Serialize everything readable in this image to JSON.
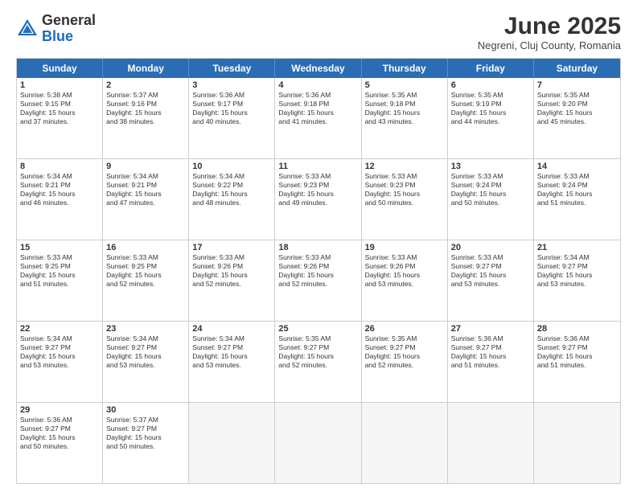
{
  "header": {
    "logo_general": "General",
    "logo_blue": "Blue",
    "month_year": "June 2025",
    "location": "Negreni, Cluj County, Romania"
  },
  "weekdays": [
    "Sunday",
    "Monday",
    "Tuesday",
    "Wednesday",
    "Thursday",
    "Friday",
    "Saturday"
  ],
  "rows": [
    [
      {
        "day": "",
        "empty": true,
        "text": ""
      },
      {
        "day": "2",
        "empty": false,
        "text": "Sunrise: 5:37 AM\nSunset: 9:16 PM\nDaylight: 15 hours\nand 38 minutes."
      },
      {
        "day": "3",
        "empty": false,
        "text": "Sunrise: 5:36 AM\nSunset: 9:17 PM\nDaylight: 15 hours\nand 40 minutes."
      },
      {
        "day": "4",
        "empty": false,
        "text": "Sunrise: 5:36 AM\nSunset: 9:18 PM\nDaylight: 15 hours\nand 41 minutes."
      },
      {
        "day": "5",
        "empty": false,
        "text": "Sunrise: 5:35 AM\nSunset: 9:18 PM\nDaylight: 15 hours\nand 43 minutes."
      },
      {
        "day": "6",
        "empty": false,
        "text": "Sunrise: 5:35 AM\nSunset: 9:19 PM\nDaylight: 15 hours\nand 44 minutes."
      },
      {
        "day": "7",
        "empty": false,
        "text": "Sunrise: 5:35 AM\nSunset: 9:20 PM\nDaylight: 15 hours\nand 45 minutes."
      }
    ],
    [
      {
        "day": "8",
        "empty": false,
        "text": "Sunrise: 5:34 AM\nSunset: 9:21 PM\nDaylight: 15 hours\nand 46 minutes."
      },
      {
        "day": "9",
        "empty": false,
        "text": "Sunrise: 5:34 AM\nSunset: 9:21 PM\nDaylight: 15 hours\nand 47 minutes."
      },
      {
        "day": "10",
        "empty": false,
        "text": "Sunrise: 5:34 AM\nSunset: 9:22 PM\nDaylight: 15 hours\nand 48 minutes."
      },
      {
        "day": "11",
        "empty": false,
        "text": "Sunrise: 5:33 AM\nSunset: 9:23 PM\nDaylight: 15 hours\nand 49 minutes."
      },
      {
        "day": "12",
        "empty": false,
        "text": "Sunrise: 5:33 AM\nSunset: 9:23 PM\nDaylight: 15 hours\nand 50 minutes."
      },
      {
        "day": "13",
        "empty": false,
        "text": "Sunrise: 5:33 AM\nSunset: 9:24 PM\nDaylight: 15 hours\nand 50 minutes."
      },
      {
        "day": "14",
        "empty": false,
        "text": "Sunrise: 5:33 AM\nSunset: 9:24 PM\nDaylight: 15 hours\nand 51 minutes."
      }
    ],
    [
      {
        "day": "15",
        "empty": false,
        "text": "Sunrise: 5:33 AM\nSunset: 9:25 PM\nDaylight: 15 hours\nand 51 minutes."
      },
      {
        "day": "16",
        "empty": false,
        "text": "Sunrise: 5:33 AM\nSunset: 9:25 PM\nDaylight: 15 hours\nand 52 minutes."
      },
      {
        "day": "17",
        "empty": false,
        "text": "Sunrise: 5:33 AM\nSunset: 9:26 PM\nDaylight: 15 hours\nand 52 minutes."
      },
      {
        "day": "18",
        "empty": false,
        "text": "Sunrise: 5:33 AM\nSunset: 9:26 PM\nDaylight: 15 hours\nand 52 minutes."
      },
      {
        "day": "19",
        "empty": false,
        "text": "Sunrise: 5:33 AM\nSunset: 9:26 PM\nDaylight: 15 hours\nand 53 minutes."
      },
      {
        "day": "20",
        "empty": false,
        "text": "Sunrise: 5:33 AM\nSunset: 9:27 PM\nDaylight: 15 hours\nand 53 minutes."
      },
      {
        "day": "21",
        "empty": false,
        "text": "Sunrise: 5:34 AM\nSunset: 9:27 PM\nDaylight: 15 hours\nand 53 minutes."
      }
    ],
    [
      {
        "day": "22",
        "empty": false,
        "text": "Sunrise: 5:34 AM\nSunset: 9:27 PM\nDaylight: 15 hours\nand 53 minutes."
      },
      {
        "day": "23",
        "empty": false,
        "text": "Sunrise: 5:34 AM\nSunset: 9:27 PM\nDaylight: 15 hours\nand 53 minutes."
      },
      {
        "day": "24",
        "empty": false,
        "text": "Sunrise: 5:34 AM\nSunset: 9:27 PM\nDaylight: 15 hours\nand 53 minutes."
      },
      {
        "day": "25",
        "empty": false,
        "text": "Sunrise: 5:35 AM\nSunset: 9:27 PM\nDaylight: 15 hours\nand 52 minutes."
      },
      {
        "day": "26",
        "empty": false,
        "text": "Sunrise: 5:35 AM\nSunset: 9:27 PM\nDaylight: 15 hours\nand 52 minutes."
      },
      {
        "day": "27",
        "empty": false,
        "text": "Sunrise: 5:36 AM\nSunset: 9:27 PM\nDaylight: 15 hours\nand 51 minutes."
      },
      {
        "day": "28",
        "empty": false,
        "text": "Sunrise: 5:36 AM\nSunset: 9:27 PM\nDaylight: 15 hours\nand 51 minutes."
      }
    ],
    [
      {
        "day": "29",
        "empty": false,
        "text": "Sunrise: 5:36 AM\nSunset: 9:27 PM\nDaylight: 15 hours\nand 50 minutes."
      },
      {
        "day": "30",
        "empty": false,
        "text": "Sunrise: 5:37 AM\nSunset: 9:27 PM\nDaylight: 15 hours\nand 50 minutes."
      },
      {
        "day": "",
        "empty": true,
        "text": ""
      },
      {
        "day": "",
        "empty": true,
        "text": ""
      },
      {
        "day": "",
        "empty": true,
        "text": ""
      },
      {
        "day": "",
        "empty": true,
        "text": ""
      },
      {
        "day": "",
        "empty": true,
        "text": ""
      }
    ]
  ],
  "row0_sunday": {
    "day": "1",
    "text": "Sunrise: 5:38 AM\nSunset: 9:15 PM\nDaylight: 15 hours\nand 37 minutes."
  }
}
